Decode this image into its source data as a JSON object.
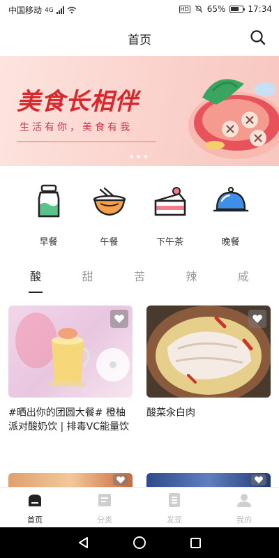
{
  "status_bar": {
    "carrier": "中国移动",
    "network": "4G",
    "hd_badge": "HD",
    "battery_text": "65%",
    "time": "17:34"
  },
  "header": {
    "title": "首页",
    "search_icon": "search-icon"
  },
  "banner": {
    "title": "美食长相伴",
    "subtitle": "生活有你，美食有我",
    "slide_count": 3,
    "active_slide": 2
  },
  "categories": [
    {
      "label": "早餐",
      "icon": "milk-bottle-icon"
    },
    {
      "label": "午餐",
      "icon": "noodle-bowl-icon"
    },
    {
      "label": "下午茶",
      "icon": "cake-icon"
    },
    {
      "label": "晚餐",
      "icon": "dish-cloche-icon"
    }
  ],
  "flavor_tabs": [
    {
      "label": "酸",
      "active": true
    },
    {
      "label": "甜",
      "active": false
    },
    {
      "label": "苦",
      "active": false
    },
    {
      "label": "辣",
      "active": false
    },
    {
      "label": "咸",
      "active": false
    }
  ],
  "recipes": [
    {
      "caption": "#晒出你的团圆大餐# 橙柚派对酸奶饮 | 排毒VC能量饮",
      "icon": "heart-icon"
    },
    {
      "caption": "酸菜汆白肉",
      "icon": "heart-icon"
    },
    {
      "caption": "",
      "icon": "heart-icon"
    },
    {
      "caption": "",
      "icon": "heart-icon"
    }
  ],
  "bottom_nav": [
    {
      "label": "首页",
      "icon": "home-icon",
      "active": true
    },
    {
      "label": "分类",
      "icon": "category-icon",
      "active": false
    },
    {
      "label": "发现",
      "icon": "discover-icon",
      "active": false
    },
    {
      "label": "我的",
      "icon": "profile-icon",
      "active": false
    }
  ],
  "system_nav": [
    "back-icon",
    "home-circle-icon",
    "recents-icon"
  ],
  "colors": {
    "banner_red": "#d8282c",
    "banner_bg": "#fbd2cc",
    "accent_green": "#5bc28a",
    "accent_orange": "#f6a04d",
    "accent_pink": "#f27b8c",
    "accent_blue": "#3f8ee8"
  }
}
